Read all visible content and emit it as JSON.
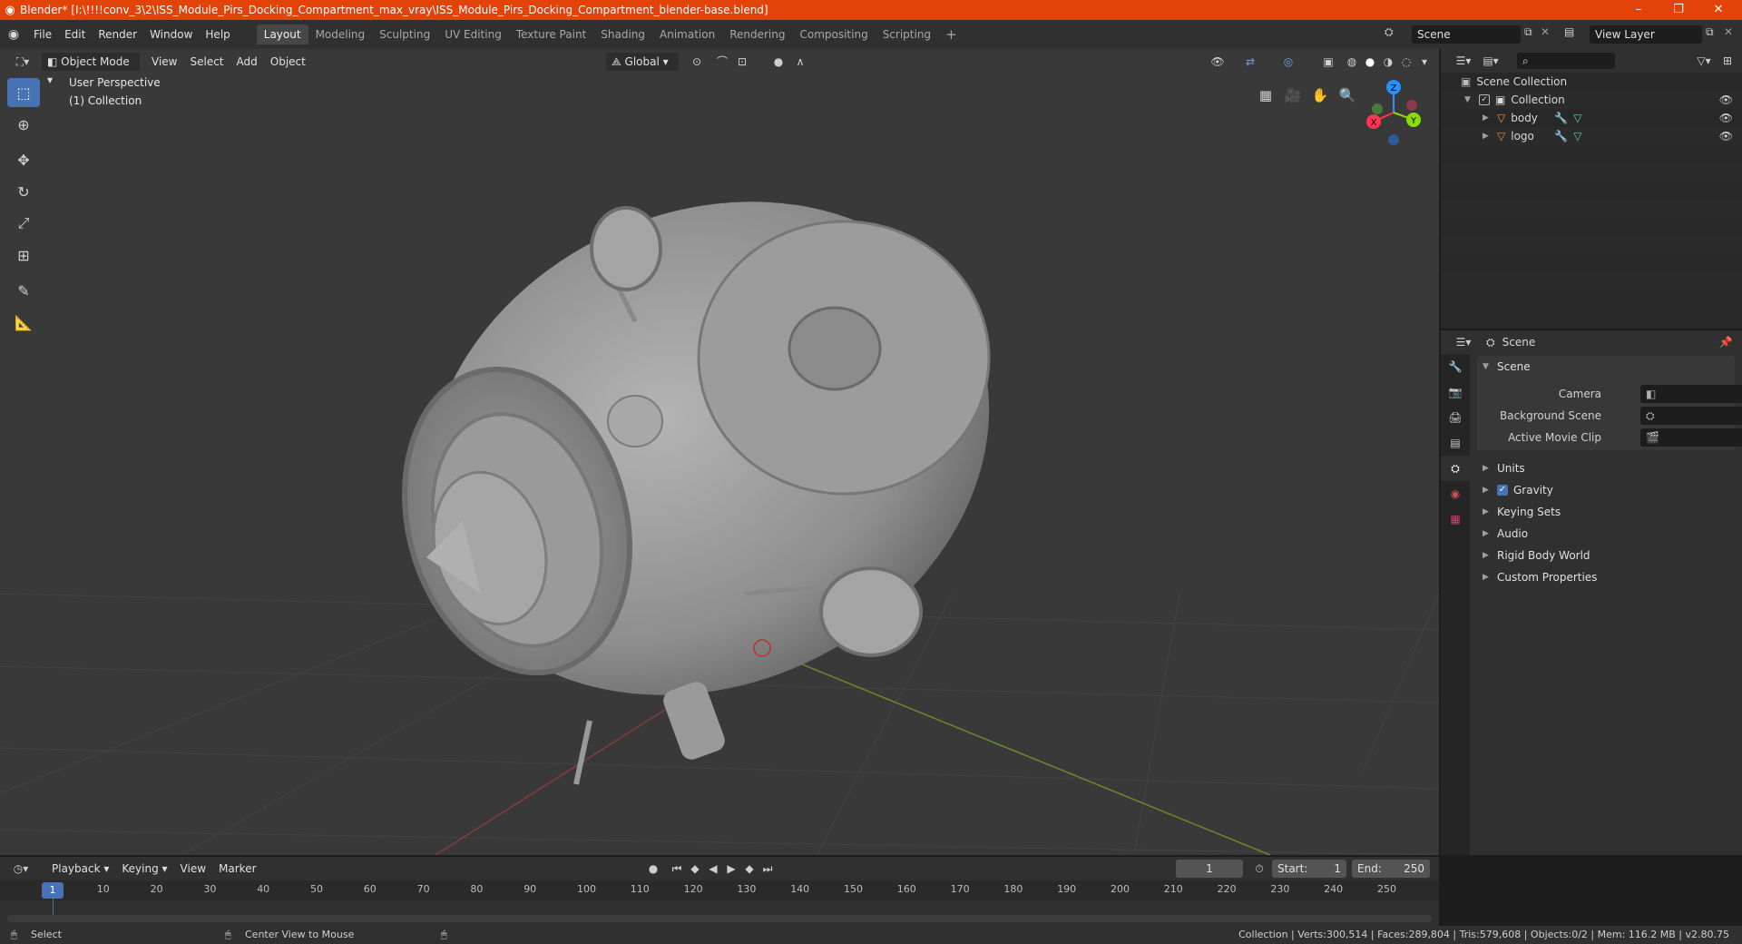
{
  "window": {
    "title": "Blender* [I:\\!!!!conv_3\\2\\ISS_Module_Pirs_Docking_Compartment_max_vray\\ISS_Module_Pirs_Docking_Compartment_blender-base.blend]",
    "minimize": "–",
    "restore": "❐",
    "close": "✕"
  },
  "menubar": {
    "items": [
      "File",
      "Edit",
      "Render",
      "Window",
      "Help"
    ]
  },
  "workspaces": {
    "tabs": [
      "Layout",
      "Modeling",
      "Sculpting",
      "UV Editing",
      "Texture Paint",
      "Shading",
      "Animation",
      "Rendering",
      "Compositing",
      "Scripting"
    ],
    "active": "Layout",
    "add": "+"
  },
  "scene_selector": {
    "value": "Scene"
  },
  "view_layer_selector": {
    "value": "View Layer"
  },
  "viewport": {
    "mode": "Object Mode",
    "menus": [
      "View",
      "Select",
      "Add",
      "Object"
    ],
    "orientation": "Global",
    "overlay_text": {
      "perspective": "User Perspective",
      "collection": "(1) Collection"
    },
    "gizmo": {
      "x": "X",
      "y": "Y",
      "z": "Z"
    }
  },
  "outliner": {
    "search_placeholder": "",
    "root": "Scene Collection",
    "collection": "Collection",
    "objects": [
      "body",
      "logo"
    ]
  },
  "properties": {
    "header": "Scene",
    "panel_title": "Scene",
    "fields": [
      {
        "label": "Camera",
        "value": ""
      },
      {
        "label": "Background Scene",
        "value": ""
      },
      {
        "label": "Active Movie Clip",
        "value": ""
      }
    ],
    "subpanels": [
      "Units",
      "Gravity",
      "Keying Sets",
      "Audio",
      "Rigid Body World",
      "Custom Properties"
    ],
    "gravity_checked": true
  },
  "timeline": {
    "menus": [
      "Playback",
      "Keying",
      "View",
      "Marker"
    ],
    "current_frame": "1",
    "start_label": "Start:",
    "start": "1",
    "end_label": "End:",
    "end": "250",
    "ruler": [
      "10",
      "20",
      "30",
      "40",
      "50",
      "60",
      "70",
      "80",
      "90",
      "100",
      "110",
      "120",
      "130",
      "140",
      "150",
      "160",
      "170",
      "180",
      "190",
      "200",
      "210",
      "220",
      "230",
      "240",
      "250"
    ],
    "playhead_label": "1"
  },
  "statusbar": {
    "left1": "Select",
    "left2": "Center View to Mouse",
    "right": "Collection | Verts:300,514 | Faces:289,804 | Tris:579,608 | Objects:0/2 | Mem: 116.2 MB | v2.80.75"
  },
  "colors": {
    "titlebar": "#e34208",
    "accent": "#4772b3",
    "axis_x": "#ff3352",
    "axis_y": "#8bdc00",
    "axis_z": "#2890ff"
  }
}
